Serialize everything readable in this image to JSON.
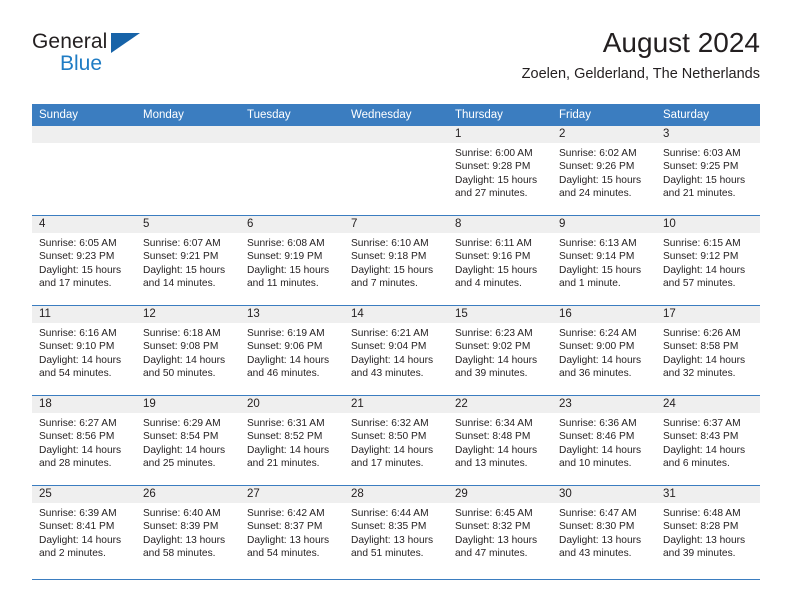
{
  "brand": {
    "name_part1": "General",
    "name_part2": "Blue",
    "logo_icon": "triangle-flag-icon"
  },
  "header": {
    "month_title": "August 2024",
    "location": "Zoelen, Gelderland, The Netherlands"
  },
  "calendar": {
    "weekday_headers": [
      "Sunday",
      "Monday",
      "Tuesday",
      "Wednesday",
      "Thursday",
      "Friday",
      "Saturday"
    ],
    "weeks": [
      [
        {
          "day": "",
          "sunrise": "",
          "sunset": "",
          "daylight_line1": "",
          "daylight_line2": ""
        },
        {
          "day": "",
          "sunrise": "",
          "sunset": "",
          "daylight_line1": "",
          "daylight_line2": ""
        },
        {
          "day": "",
          "sunrise": "",
          "sunset": "",
          "daylight_line1": "",
          "daylight_line2": ""
        },
        {
          "day": "",
          "sunrise": "",
          "sunset": "",
          "daylight_line1": "",
          "daylight_line2": ""
        },
        {
          "day": "1",
          "sunrise": "Sunrise: 6:00 AM",
          "sunset": "Sunset: 9:28 PM",
          "daylight_line1": "Daylight: 15 hours",
          "daylight_line2": "and 27 minutes."
        },
        {
          "day": "2",
          "sunrise": "Sunrise: 6:02 AM",
          "sunset": "Sunset: 9:26 PM",
          "daylight_line1": "Daylight: 15 hours",
          "daylight_line2": "and 24 minutes."
        },
        {
          "day": "3",
          "sunrise": "Sunrise: 6:03 AM",
          "sunset": "Sunset: 9:25 PM",
          "daylight_line1": "Daylight: 15 hours",
          "daylight_line2": "and 21 minutes."
        }
      ],
      [
        {
          "day": "4",
          "sunrise": "Sunrise: 6:05 AM",
          "sunset": "Sunset: 9:23 PM",
          "daylight_line1": "Daylight: 15 hours",
          "daylight_line2": "and 17 minutes."
        },
        {
          "day": "5",
          "sunrise": "Sunrise: 6:07 AM",
          "sunset": "Sunset: 9:21 PM",
          "daylight_line1": "Daylight: 15 hours",
          "daylight_line2": "and 14 minutes."
        },
        {
          "day": "6",
          "sunrise": "Sunrise: 6:08 AM",
          "sunset": "Sunset: 9:19 PM",
          "daylight_line1": "Daylight: 15 hours",
          "daylight_line2": "and 11 minutes."
        },
        {
          "day": "7",
          "sunrise": "Sunrise: 6:10 AM",
          "sunset": "Sunset: 9:18 PM",
          "daylight_line1": "Daylight: 15 hours",
          "daylight_line2": "and 7 minutes."
        },
        {
          "day": "8",
          "sunrise": "Sunrise: 6:11 AM",
          "sunset": "Sunset: 9:16 PM",
          "daylight_line1": "Daylight: 15 hours",
          "daylight_line2": "and 4 minutes."
        },
        {
          "day": "9",
          "sunrise": "Sunrise: 6:13 AM",
          "sunset": "Sunset: 9:14 PM",
          "daylight_line1": "Daylight: 15 hours",
          "daylight_line2": "and 1 minute."
        },
        {
          "day": "10",
          "sunrise": "Sunrise: 6:15 AM",
          "sunset": "Sunset: 9:12 PM",
          "daylight_line1": "Daylight: 14 hours",
          "daylight_line2": "and 57 minutes."
        }
      ],
      [
        {
          "day": "11",
          "sunrise": "Sunrise: 6:16 AM",
          "sunset": "Sunset: 9:10 PM",
          "daylight_line1": "Daylight: 14 hours",
          "daylight_line2": "and 54 minutes."
        },
        {
          "day": "12",
          "sunrise": "Sunrise: 6:18 AM",
          "sunset": "Sunset: 9:08 PM",
          "daylight_line1": "Daylight: 14 hours",
          "daylight_line2": "and 50 minutes."
        },
        {
          "day": "13",
          "sunrise": "Sunrise: 6:19 AM",
          "sunset": "Sunset: 9:06 PM",
          "daylight_line1": "Daylight: 14 hours",
          "daylight_line2": "and 46 minutes."
        },
        {
          "day": "14",
          "sunrise": "Sunrise: 6:21 AM",
          "sunset": "Sunset: 9:04 PM",
          "daylight_line1": "Daylight: 14 hours",
          "daylight_line2": "and 43 minutes."
        },
        {
          "day": "15",
          "sunrise": "Sunrise: 6:23 AM",
          "sunset": "Sunset: 9:02 PM",
          "daylight_line1": "Daylight: 14 hours",
          "daylight_line2": "and 39 minutes."
        },
        {
          "day": "16",
          "sunrise": "Sunrise: 6:24 AM",
          "sunset": "Sunset: 9:00 PM",
          "daylight_line1": "Daylight: 14 hours",
          "daylight_line2": "and 36 minutes."
        },
        {
          "day": "17",
          "sunrise": "Sunrise: 6:26 AM",
          "sunset": "Sunset: 8:58 PM",
          "daylight_line1": "Daylight: 14 hours",
          "daylight_line2": "and 32 minutes."
        }
      ],
      [
        {
          "day": "18",
          "sunrise": "Sunrise: 6:27 AM",
          "sunset": "Sunset: 8:56 PM",
          "daylight_line1": "Daylight: 14 hours",
          "daylight_line2": "and 28 minutes."
        },
        {
          "day": "19",
          "sunrise": "Sunrise: 6:29 AM",
          "sunset": "Sunset: 8:54 PM",
          "daylight_line1": "Daylight: 14 hours",
          "daylight_line2": "and 25 minutes."
        },
        {
          "day": "20",
          "sunrise": "Sunrise: 6:31 AM",
          "sunset": "Sunset: 8:52 PM",
          "daylight_line1": "Daylight: 14 hours",
          "daylight_line2": "and 21 minutes."
        },
        {
          "day": "21",
          "sunrise": "Sunrise: 6:32 AM",
          "sunset": "Sunset: 8:50 PM",
          "daylight_line1": "Daylight: 14 hours",
          "daylight_line2": "and 17 minutes."
        },
        {
          "day": "22",
          "sunrise": "Sunrise: 6:34 AM",
          "sunset": "Sunset: 8:48 PM",
          "daylight_line1": "Daylight: 14 hours",
          "daylight_line2": "and 13 minutes."
        },
        {
          "day": "23",
          "sunrise": "Sunrise: 6:36 AM",
          "sunset": "Sunset: 8:46 PM",
          "daylight_line1": "Daylight: 14 hours",
          "daylight_line2": "and 10 minutes."
        },
        {
          "day": "24",
          "sunrise": "Sunrise: 6:37 AM",
          "sunset": "Sunset: 8:43 PM",
          "daylight_line1": "Daylight: 14 hours",
          "daylight_line2": "and 6 minutes."
        }
      ],
      [
        {
          "day": "25",
          "sunrise": "Sunrise: 6:39 AM",
          "sunset": "Sunset: 8:41 PM",
          "daylight_line1": "Daylight: 14 hours",
          "daylight_line2": "and 2 minutes."
        },
        {
          "day": "26",
          "sunrise": "Sunrise: 6:40 AM",
          "sunset": "Sunset: 8:39 PM",
          "daylight_line1": "Daylight: 13 hours",
          "daylight_line2": "and 58 minutes."
        },
        {
          "day": "27",
          "sunrise": "Sunrise: 6:42 AM",
          "sunset": "Sunset: 8:37 PM",
          "daylight_line1": "Daylight: 13 hours",
          "daylight_line2": "and 54 minutes."
        },
        {
          "day": "28",
          "sunrise": "Sunrise: 6:44 AM",
          "sunset": "Sunset: 8:35 PM",
          "daylight_line1": "Daylight: 13 hours",
          "daylight_line2": "and 51 minutes."
        },
        {
          "day": "29",
          "sunrise": "Sunrise: 6:45 AM",
          "sunset": "Sunset: 8:32 PM",
          "daylight_line1": "Daylight: 13 hours",
          "daylight_line2": "and 47 minutes."
        },
        {
          "day": "30",
          "sunrise": "Sunrise: 6:47 AM",
          "sunset": "Sunset: 8:30 PM",
          "daylight_line1": "Daylight: 13 hours",
          "daylight_line2": "and 43 minutes."
        },
        {
          "day": "31",
          "sunrise": "Sunrise: 6:48 AM",
          "sunset": "Sunset: 8:28 PM",
          "daylight_line1": "Daylight: 13 hours",
          "daylight_line2": "and 39 minutes."
        }
      ]
    ]
  },
  "colors": {
    "header_blue": "#3b7dc0",
    "brand_blue": "#1f7cc4",
    "logo_blue": "#1763a8",
    "day_band_grey": "#efefef",
    "text": "#231f20"
  }
}
